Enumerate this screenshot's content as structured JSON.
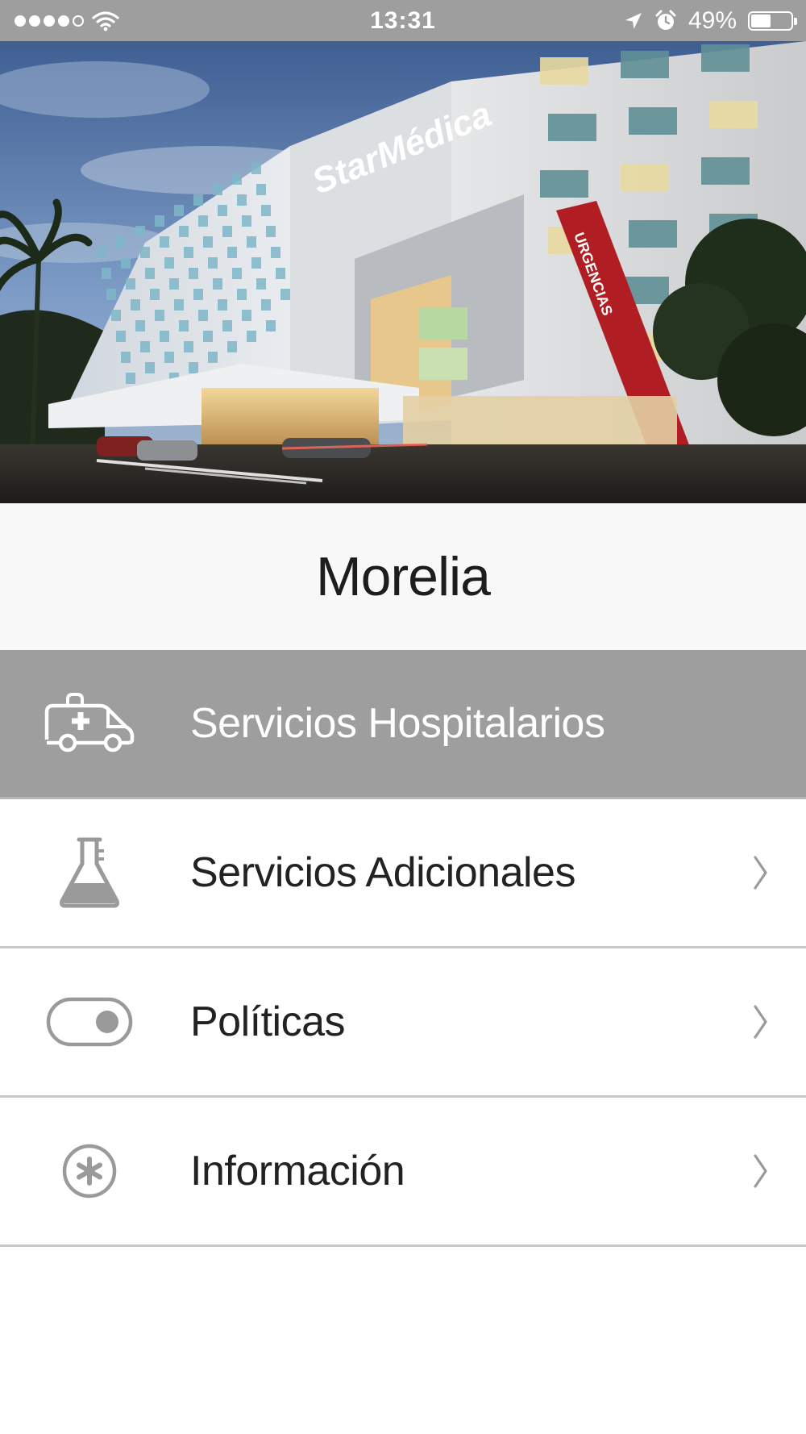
{
  "status_bar": {
    "signal_dots_filled": 4,
    "signal_dots_total": 5,
    "wifi_icon": "wifi-icon",
    "time": "13:31",
    "location_icon": "location-arrow-icon",
    "alarm_icon": "alarm-clock-icon",
    "battery_percent_label": "49%",
    "battery_level": 0.49
  },
  "hero": {
    "image": "hospital-building-photo",
    "sign_text": "StarMédica",
    "tower_sign_text": "URGENCIAS"
  },
  "page": {
    "title": "Morelia"
  },
  "menu": {
    "items": [
      {
        "label": "Servicios Hospitalarios",
        "icon": "ambulance-icon",
        "active": true,
        "has_chevron": false
      },
      {
        "label": "Servicios Adicionales",
        "icon": "flask-icon",
        "active": false,
        "has_chevron": true
      },
      {
        "label": "Políticas",
        "icon": "toggle-icon",
        "active": false,
        "has_chevron": true
      },
      {
        "label": "Información",
        "icon": "asterisk-circle-icon",
        "active": false,
        "has_chevron": true
      }
    ]
  },
  "colors": {
    "status_bar_bg": "#9e9e9e",
    "active_row_bg": "#9e9e9e",
    "title_area_bg": "#f8f8f8",
    "icon_gray": "#9a9a9a",
    "divider": "#c8c8c8",
    "accent_red": "#b01e24"
  }
}
